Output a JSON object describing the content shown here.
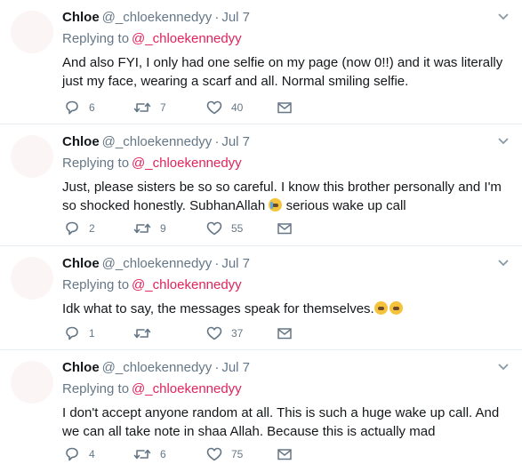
{
  "tweets": [
    {
      "name": "Chloe",
      "handle": "@_chloekennedyy",
      "separator": "·",
      "time": "Jul 7",
      "replying_prefix": "Replying to",
      "replying_to": "@_chloekennedyy",
      "text": "And also FYI, I only had one selfie on my page (now 0!!) and it was literally just my face, wearing a scarf and all. Normal smiling selfie.",
      "replies": "6",
      "retweets": "7",
      "likes": "40"
    },
    {
      "name": "Chloe",
      "handle": "@_chloekennedyy",
      "separator": "·",
      "time": "Jul 7",
      "replying_prefix": "Replying to",
      "replying_to": "@_chloekennedyy",
      "text_a": "Just, please sisters be so so careful. I know this brother personally and I'm so shocked honestly. SubhanAllah",
      "text_b": "serious wake up call",
      "replies": "2",
      "retweets": "9",
      "likes": "55"
    },
    {
      "name": "Chloe",
      "handle": "@_chloekennedyy",
      "separator": "·",
      "time": "Jul 7",
      "replying_prefix": "Replying to",
      "replying_to": "@_chloekennedyy",
      "text": "Idk what to say, the messages speak for themselves.",
      "replies": "1",
      "retweets": "",
      "likes": "37"
    },
    {
      "name": "Chloe",
      "handle": "@_chloekennedyy",
      "separator": "·",
      "time": "Jul 7",
      "replying_prefix": "Replying to",
      "replying_to": "@_chloekennedyy",
      "text": "I don't accept anyone random at all. This is such a huge wake up call. And we can all take note in shaa Allah. Because this is actually mad",
      "replies": "4",
      "retweets": "6",
      "likes": "75"
    }
  ],
  "icons": {
    "reply": "reply-icon",
    "retweet": "retweet-icon",
    "like": "heart-icon",
    "dm": "envelope-icon",
    "caret": "chevron-down-icon",
    "emoji_crying": "loudly-crying-face-icon",
    "emoji_weary": "weary-face-icon"
  },
  "colors": {
    "mention": "#e0245e",
    "secondary_text": "#657786",
    "divider": "#e6ecf0"
  }
}
